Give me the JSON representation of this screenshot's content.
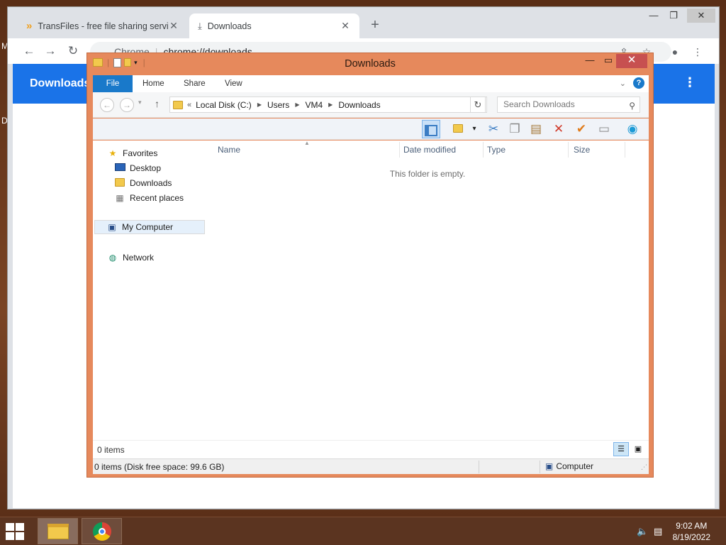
{
  "desktop": {
    "edge_letters": [
      "M",
      "D"
    ]
  },
  "chrome": {
    "tabs": [
      {
        "title": "TransFiles - free file sharing servi",
        "icon": "transfiles-chevron-icon"
      },
      {
        "title": "Downloads",
        "icon": "download-arrow-icon"
      }
    ],
    "new_tab_label": "+",
    "omnibox": {
      "scheme_label": "Chrome",
      "url": "chrome://downloads"
    },
    "page": {
      "title": "Downloads",
      "menu_label": "⋮"
    }
  },
  "explorer": {
    "title": "Downloads",
    "ribbon_tabs": [
      "File",
      "Home",
      "Share",
      "View"
    ],
    "address": {
      "prefix": "«",
      "crumbs": [
        "Local Disk (C:)",
        "Users",
        "VM4",
        "Downloads"
      ]
    },
    "search_placeholder": "Search Downloads",
    "nav": {
      "favorites": "Favorites",
      "desktop": "Desktop",
      "downloads": "Downloads",
      "recent": "Recent places",
      "computer": "My Computer",
      "network": "Network"
    },
    "columns": [
      "Name",
      "Date modified",
      "Type",
      "Size"
    ],
    "empty_message": "This folder is empty.",
    "item_count": "0 items",
    "status": {
      "left": "0 items (Disk free space: 99.6 GB)",
      "right": "Computer"
    }
  },
  "taskbar": {
    "clock_time": "9:02 AM",
    "clock_date": "8/19/2022"
  },
  "colors": {
    "explorer_frame": "#e6895c",
    "chrome_accent": "#1a73e8",
    "explorer_file_tab": "#1979ca",
    "close_button": "#c75050"
  }
}
